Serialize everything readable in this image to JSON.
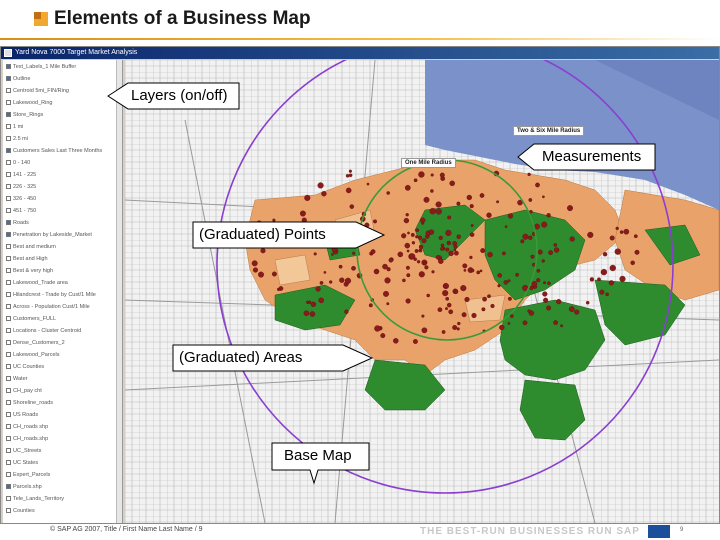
{
  "slide": {
    "title": "Elements of a Business Map"
  },
  "window": {
    "title": "Yard Nova 7000 Target Market Analysis"
  },
  "legend": {
    "items": [
      {
        "label": "Text_Labels_1 Mile Buffer",
        "checked": true
      },
      {
        "label": "Outline",
        "checked": true
      },
      {
        "label": "Centroid 5mi_FIN/Ring",
        "checked": false
      },
      {
        "label": "Lakewood_Ring",
        "checked": false
      },
      {
        "label": "Store_Rings",
        "checked": true
      },
      {
        "label": "1 mi",
        "checked": false
      },
      {
        "label": "2.5 mi",
        "checked": false
      },
      {
        "label": "Customers Sales Last Three Months",
        "checked": true
      },
      {
        "label": "0 - 140",
        "checked": false
      },
      {
        "label": "141 - 225",
        "checked": false
      },
      {
        "label": "226 - 325",
        "checked": false
      },
      {
        "label": "326 - 450",
        "checked": false
      },
      {
        "label": "451 - 750",
        "checked": false
      },
      {
        "label": "Roads",
        "checked": true
      },
      {
        "label": "Penetration by Lakeside_Market",
        "checked": true
      },
      {
        "label": "Best and medium",
        "checked": false
      },
      {
        "label": "Best and High",
        "checked": false
      },
      {
        "label": "Best & very high",
        "checked": false
      },
      {
        "label": "Lakewood_Trade area",
        "checked": false
      },
      {
        "label": "Hilandcrest - Trade by Cust/1 Mile",
        "checked": false
      },
      {
        "label": "Across - Population Cust/1 Mile",
        "checked": false
      },
      {
        "label": "Customers_FULL",
        "checked": false
      },
      {
        "label": "Locations - Cluster Centroid",
        "checked": false
      },
      {
        "label": "Dense_Customers_2",
        "checked": false
      },
      {
        "label": "Lakewood_Parcels",
        "checked": false
      },
      {
        "label": "UC Counties",
        "checked": false
      },
      {
        "label": "Water",
        "checked": false
      },
      {
        "label": "CH_pay cht",
        "checked": false
      },
      {
        "label": "Shoreline_roads",
        "checked": false
      },
      {
        "label": "US Roads",
        "checked": false
      },
      {
        "label": "CH_roads shp",
        "checked": false
      },
      {
        "label": "CH_roads.shp",
        "checked": false
      },
      {
        "label": "UC_Streets",
        "checked": false
      },
      {
        "label": "UC States",
        "checked": false
      },
      {
        "label": "Expert_Parcels",
        "checked": false
      },
      {
        "label": "Parcels.shp",
        "checked": true
      },
      {
        "label": "Tele_Lands_Territory",
        "checked": false
      },
      {
        "label": "Counties",
        "checked": false
      }
    ]
  },
  "map": {
    "labels": {
      "two_six_mile": "Two & Six Mile Radius",
      "one_mile": "One Mile Radius"
    },
    "colors": {
      "water": "#7b91c9",
      "orange": "#e9a36a",
      "green": "#2e8b2e",
      "point": "#8b1a1a",
      "ring_outer": "#8a3fd1",
      "ring_inner": "#3a9a3a"
    }
  },
  "callouts": [
    {
      "label": "Layers (on/off)"
    },
    {
      "label": "Measurements"
    },
    {
      "label": "(Graduated) Points"
    },
    {
      "label": "(Graduated) Areas"
    },
    {
      "label": "Base Map"
    }
  ],
  "footer": {
    "copyright": "© SAP AG 2007, Title / First Name Last Name / 9",
    "brand": "THE BEST-RUN BUSINESSES RUN SAP",
    "page": "9"
  }
}
